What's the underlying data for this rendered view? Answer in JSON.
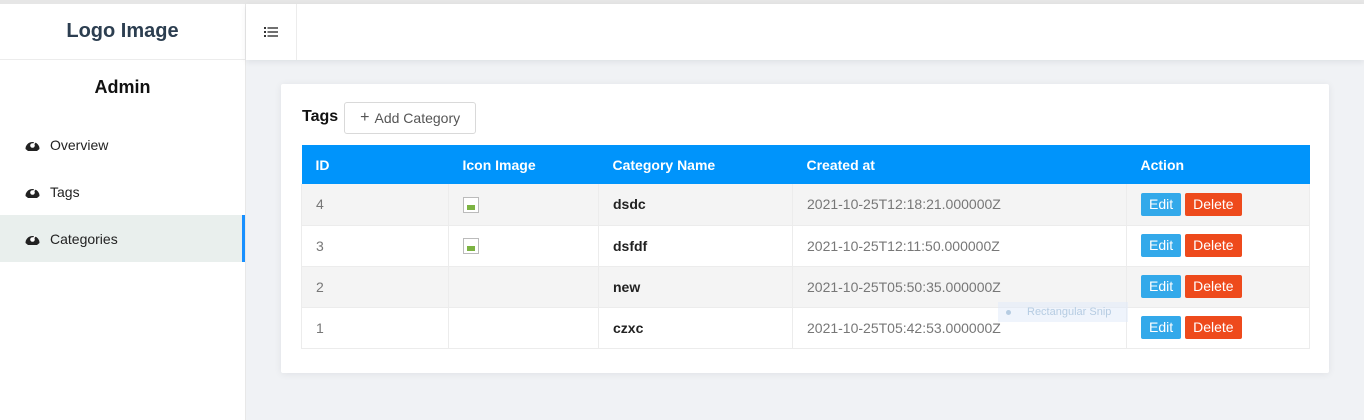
{
  "sidebar": {
    "logo": "Logo Image",
    "role_title": "Admin",
    "items": [
      {
        "label": "Overview",
        "icon": "dashboard-icon",
        "active": false
      },
      {
        "label": "Tags",
        "icon": "dashboard-icon",
        "active": false
      },
      {
        "label": "Categories",
        "icon": "dashboard-icon",
        "active": true
      }
    ]
  },
  "header": {
    "menu_icon": "menu-toggle-icon"
  },
  "main": {
    "title": "Tags",
    "add_button": {
      "icon": "plus-icon",
      "label": "Add Category"
    },
    "table": {
      "columns": [
        "ID",
        "Icon Image",
        "Category Name",
        "Created at",
        "Action"
      ],
      "rows": [
        {
          "id": "4",
          "icon_image": "broken-image-icon",
          "name": "dsdc",
          "created_at": "2021-10-25T12:18:21.000000Z"
        },
        {
          "id": "3",
          "icon_image": "broken-image-icon",
          "name": "dsfdf",
          "created_at": "2021-10-25T12:11:50.000000Z"
        },
        {
          "id": "2",
          "icon_image": "",
          "name": "new",
          "created_at": "2021-10-25T05:50:35.000000Z"
        },
        {
          "id": "1",
          "icon_image": "",
          "name": "czxc",
          "created_at": "2021-10-25T05:42:53.000000Z"
        }
      ],
      "actions": {
        "edit": "Edit",
        "delete": "Delete"
      }
    }
  },
  "overlay": {
    "snip_label": "Rectangular Snip"
  },
  "colors": {
    "header_blue": "#0094fb",
    "edit_button": "#33a9ea",
    "delete_button": "#ee4a1c",
    "active_menu_border": "#1890ff"
  }
}
